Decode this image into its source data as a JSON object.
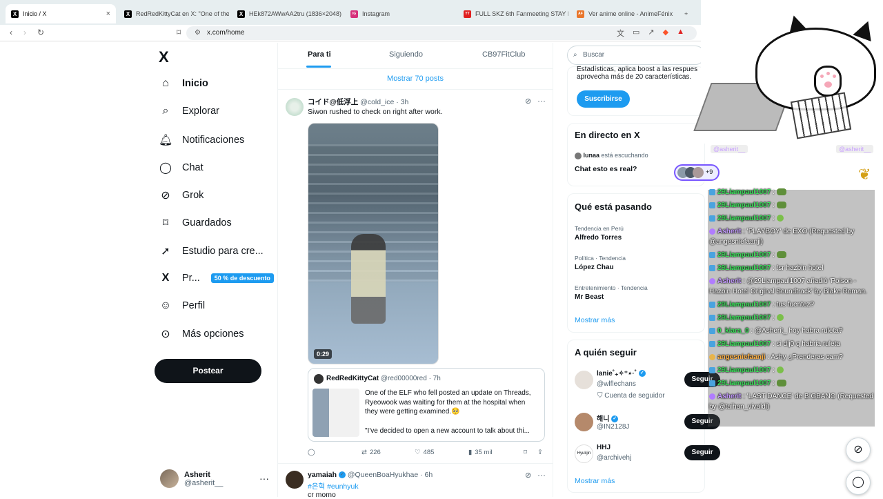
{
  "browser": {
    "tabs": [
      {
        "label": "Inicio / X",
        "icon": "X"
      },
      {
        "label": "RedRedKittyCat en X: \"One of the ELF",
        "icon": "X"
      },
      {
        "label": "HEk872AWwAA2tru (1836×2048)",
        "icon": "X"
      },
      {
        "label": "Instagram",
        "icon": "IG"
      },
      {
        "label": "FULL SKZ 6th Fanmeeting STAY In Cu",
        "icon": "YT"
      },
      {
        "label": "Ver anime online - AnimeFénix",
        "icon": "AF"
      }
    ],
    "url": "x.com/home",
    "new_tab": "+"
  },
  "nav": {
    "logo": "X",
    "items": [
      {
        "label": "Inicio",
        "icon": "home-icon",
        "glyph": "⌂"
      },
      {
        "label": "Explorar",
        "icon": "search-icon",
        "glyph": "⌕"
      },
      {
        "label": "Notificaciones",
        "icon": "bell-icon",
        "glyph": "♪"
      },
      {
        "label": "Chat",
        "icon": "chat-icon",
        "glyph": "◯"
      },
      {
        "label": "Grok",
        "icon": "grok-icon",
        "glyph": "⊘"
      },
      {
        "label": "Guardados",
        "icon": "bookmark-icon",
        "glyph": "⌑"
      },
      {
        "label": "Estudio para cre...",
        "icon": "rocket-icon",
        "glyph": "➚"
      },
      {
        "label": "Pr...",
        "icon": "x-premium-icon",
        "glyph": "X"
      },
      {
        "label": "Perfil",
        "icon": "person-icon",
        "glyph": "☺"
      },
      {
        "label": "Más opciones",
        "icon": "more-circle-icon",
        "glyph": "⋯"
      }
    ],
    "premium_badge": "50 % de descuento",
    "post_button": "Postear",
    "user": {
      "name": "Asherit",
      "handle": "@asherit__",
      "more": "···"
    }
  },
  "feed": {
    "tabs": [
      "Para ti",
      "Siguiendo",
      "CB97FitClub"
    ],
    "show_more": "Mostrar 70 posts",
    "tweet1": {
      "name": "コイド@低浮上",
      "handle": "@cold_ice",
      "time": "· 3h",
      "text": "Siwon rushed to check on right after work.",
      "duration": "0:29",
      "quote": {
        "name": "RedRedKittyCat",
        "handle": "@red00000red",
        "time": "· 7h",
        "text": "One of the ELF who fell posted an update on Threads, Ryeowook was waiting for them at the hospital when they were getting examined.🥺",
        "text2": "\"I've decided to open a new account to talk about thi..."
      },
      "stats": {
        "replies": "",
        "reposts": "226",
        "likes": "485",
        "views": "35 mil"
      }
    },
    "tweet2": {
      "name": "yamaiah",
      "handle": "@QueenBoaHyukhae",
      "time": "· 6h",
      "hashtags": "#은혁 #eunhyuk",
      "text": "cr momo"
    }
  },
  "right": {
    "search_placeholder": "Buscar",
    "premium_text_1": "Estadísticas, aplica boost a las respues",
    "premium_text_2": "aprovecha más de 20 características.",
    "subscribe": "Suscribirse",
    "live": {
      "title": "En directo en X",
      "host": "lunaa",
      "listening": "está escuchando",
      "space_title": "Chat esto es real?",
      "extra": "+9"
    },
    "trends": {
      "title": "Qué está pasando",
      "items": [
        {
          "category": "Tendencia en Perú",
          "name": "Alfredo Torres"
        },
        {
          "category": "Política · Tendencia",
          "name": "López Chau"
        },
        {
          "category": "Entretenimiento · Tendencia",
          "name": "Mr Beast"
        }
      ],
      "more": "Mostrar más"
    },
    "who": {
      "title": "A quién seguir",
      "items": [
        {
          "name": "lanie˚₊✧⁺⋆·˚",
          "handle": "@wlflechans",
          "extra": "Cuenta de seguidor",
          "button": "Seguir"
        },
        {
          "name": "해니",
          "handle": "@IN2128J",
          "extra": "",
          "button": "Seguir"
        },
        {
          "name": "HHJ",
          "handle": "@archivehj",
          "extra": "",
          "button": "Seguir"
        }
      ],
      "more": "Mostrar más"
    }
  },
  "stream_chat": {
    "top_users": [
      "@asherit__",
      "@asherit__"
    ],
    "lines": [
      {
        "user": "29Liampaul1007",
        "type": "green",
        "msg": ":",
        "emote": "frog"
      },
      {
        "user": "29Liampaul1007",
        "type": "green",
        "msg": ":",
        "emote": "frog"
      },
      {
        "user": "29Liampaul1007",
        "type": "green",
        "msg": ":",
        "emote": "pepe"
      },
      {
        "user": "Asherit",
        "type": "purple",
        "msg": ": 'PLAYBOY' de EXO (Requested by @angesniefaanji)"
      },
      {
        "user": "29Liampaul1007",
        "type": "green",
        "msg": ":",
        "emote": "frog"
      },
      {
        "user": "29Liampaul1007",
        "type": "green",
        "msg": ": !sr hazbin hotel"
      },
      {
        "user": "Asherit",
        "type": "purple",
        "msg": ": @29Liampaul1007 añadió 'Poison - Hazbin Hotel Original Soundtrack' by Blake Roman."
      },
      {
        "user": "29Liampaul1007",
        "type": "green",
        "msg": ": tus fuentez?"
      },
      {
        "user": "29Liampaul1007",
        "type": "green",
        "msg": ":",
        "emote": "pepe"
      },
      {
        "user": "0_kiara_0",
        "type": "green",
        "msg": ": @Asherit_ hoy habra ruleta?"
      },
      {
        "user": "29Liampaul1007",
        "type": "green",
        "msg": ": si dij0 q habria ruleta"
      },
      {
        "user": "angesniefaanji",
        "type": "orange",
        "msg": ": Ashy ¿Prenderas cam?"
      },
      {
        "user": "29Liampaul1007",
        "type": "green",
        "msg": ":",
        "emote": "pepe"
      },
      {
        "user": "29Liampaul1007",
        "type": "green",
        "msg": ":",
        "emote": "frog"
      },
      {
        "user": "Asherit",
        "type": "purple",
        "msg": ": 'LAST DANCE' de BIGBANG (Requested by @taihan_vivaldi)"
      }
    ]
  }
}
